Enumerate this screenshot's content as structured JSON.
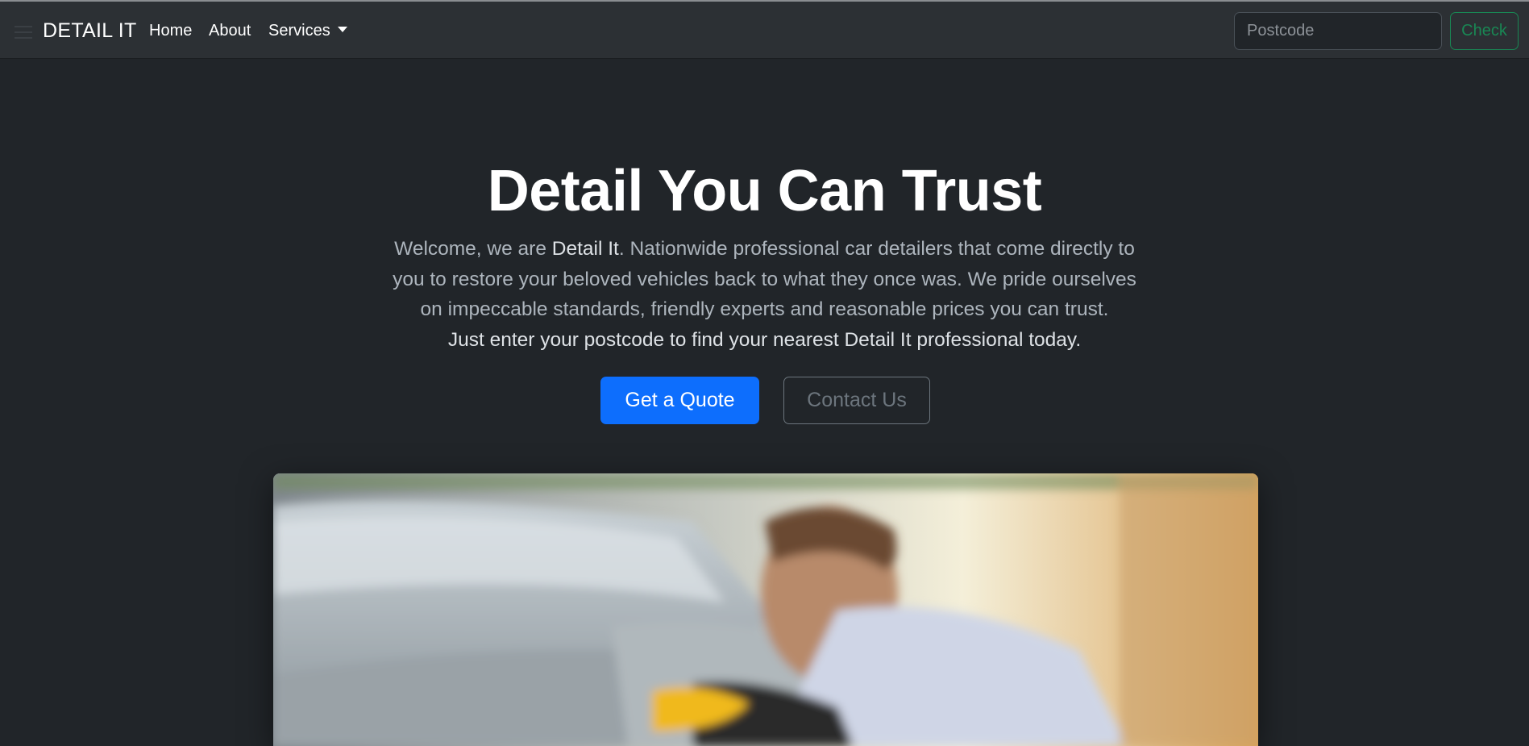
{
  "navbar": {
    "brand": "DETAIL IT",
    "links": [
      {
        "label": "Home"
      },
      {
        "label": "About"
      },
      {
        "label": "Services"
      }
    ],
    "search": {
      "placeholder": "Postcode",
      "value": "",
      "button_label": "Check"
    }
  },
  "hero": {
    "title": "Detail You Can Trust",
    "intro_before": "Welcome, we are ",
    "intro_brand": "Detail It",
    "intro_after": ". Nationwide professional car detailers that come directly to you to restore your beloved vehicles back to what they once was. We pride ourselves on impeccable standards, friendly experts and reasonable prices you can trust.",
    "cta_line": "Just enter your postcode to find your nearest Detail It professional today.",
    "primary_button": "Get a Quote",
    "secondary_button": "Contact Us"
  },
  "colors": {
    "background": "#212529",
    "navbar": "#2c3034",
    "primary": "#0d6efd",
    "success": "#198754",
    "secondary": "#6c757d"
  },
  "icons": {
    "menu": "hamburger-icon",
    "services_toggle": "caret-down-icon"
  }
}
